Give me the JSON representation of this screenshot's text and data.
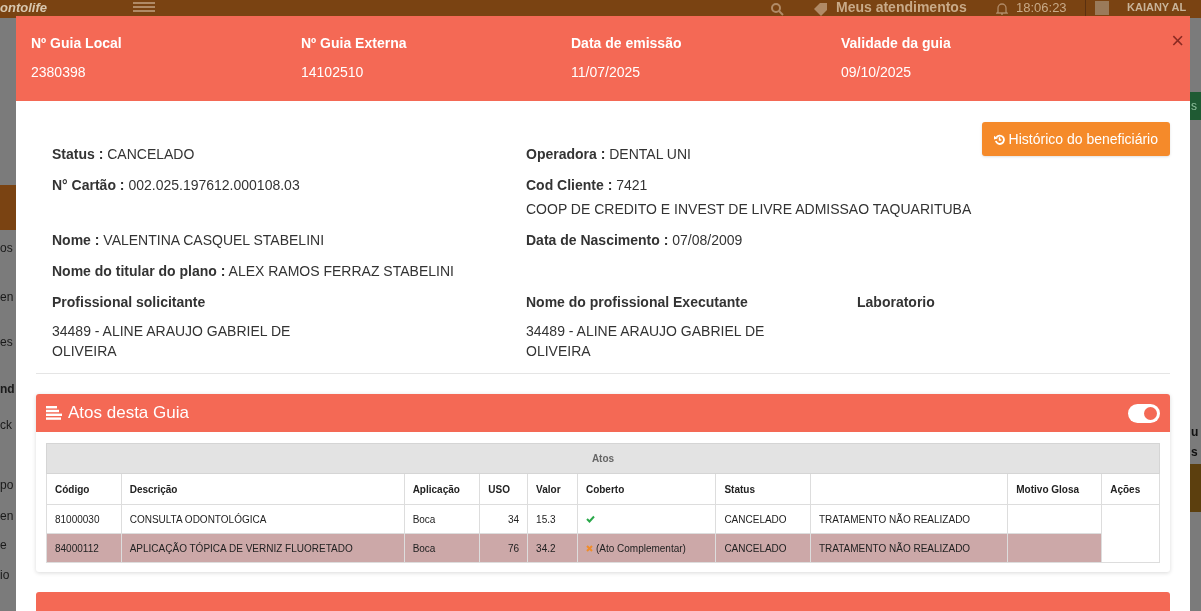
{
  "background": {
    "logo": "ontolife",
    "topbar": {
      "link": "Meus atendimentos",
      "time": "18:06:23",
      "user": "KAIANY AL"
    },
    "sidebar_fragments": [
      "os",
      "en",
      "es",
      "nd",
      "ck",
      "po",
      "en",
      "e",
      "io"
    ],
    "right_fragments": [
      "s",
      "u",
      "s"
    ]
  },
  "modal": {
    "header": [
      {
        "label": "Nº Guia Local",
        "value": "2380398"
      },
      {
        "label": "Nº Guia Externa",
        "value": "14102510"
      },
      {
        "label": "Data de emissão",
        "value": "11/07/2025"
      },
      {
        "label": "Validade da guia",
        "value": "09/10/2025"
      }
    ],
    "close": "×",
    "history_button": "Histórico do beneficiário",
    "fields_left": [
      {
        "label": "Status :",
        "value": "CANCELADO"
      },
      {
        "label": "N° Cartão :",
        "value": "002.025.197612.000108.03"
      },
      {
        "label": "Nome :",
        "value": "VALENTINA CASQUEL STABELINI"
      },
      {
        "label": "Nome do titular do plano :",
        "value": "ALEX RAMOS FERRAZ STABELINI"
      }
    ],
    "fields_right": [
      {
        "label": "Operadora :",
        "value": "DENTAL UNI"
      },
      {
        "label": "Cod Cliente :",
        "value": "7421",
        "extra": "COOP DE CREDITO E INVEST DE LIVRE ADMISSAO TAQUARITUBA"
      },
      {
        "label": "Data de Nascimento :",
        "value": "07/08/2009"
      }
    ],
    "professionals": [
      {
        "label": "Profissional solicitante",
        "value": "34489 - ALINE ARAUJO GABRIEL DE OLIVEIRA"
      },
      {
        "label": "Nome do profissional Executante",
        "value": "34489 - ALINE ARAUJO GABRIEL DE OLIVEIRA"
      },
      {
        "label": "Laboratorio"
      }
    ],
    "acts": {
      "title": "Atos desta Guia",
      "toggle_on": true,
      "caption": "Atos",
      "columns": [
        "Código",
        "Descrição",
        "Aplicação",
        "USO",
        "Valor",
        "Coberto",
        "Status",
        "",
        "Motivo Glosa",
        "Ações"
      ],
      "rows": [
        {
          "codigo": "81000030",
          "descricao": "CONSULTA ODONTOLÓGICA",
          "aplicacao": "Boca",
          "uso": "34",
          "valor": "15.3",
          "coberto": {
            "kind": "check"
          },
          "status": "CANCELADO",
          "motivo": "TRATAMENTO NÃO REALIZADO",
          "highlighted": false
        },
        {
          "codigo": "84000112",
          "descricao": "APLICAÇÃO TÓPICA DE VERNIZ FLUORETADO",
          "aplicacao": "Boca",
          "uso": "76",
          "valor": "34.2",
          "coberto": {
            "kind": "cross",
            "text": "(Ato Complementar)"
          },
          "status": "CANCELADO",
          "motivo": "TRATAMENTO NÃO REALIZADO",
          "highlighted": true
        }
      ]
    }
  }
}
